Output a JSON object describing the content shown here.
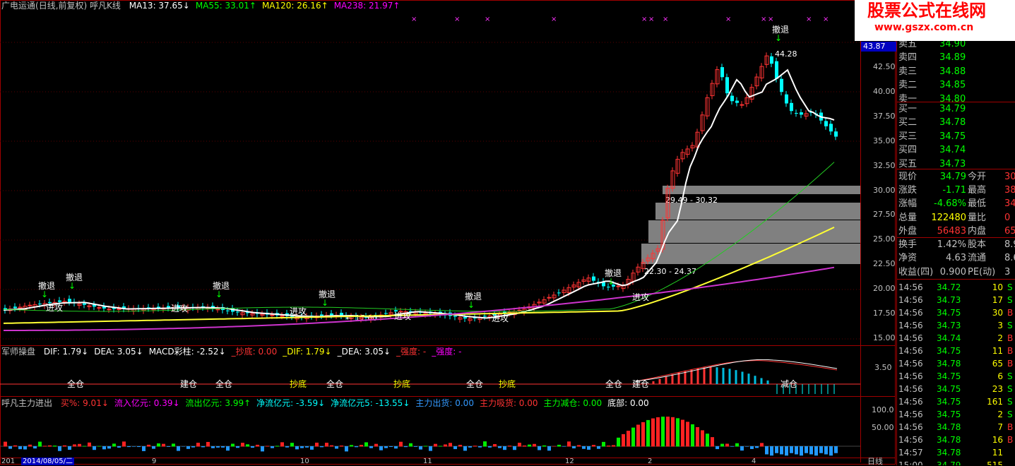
{
  "header": {
    "stock": "广电运通",
    "period": "(日线,前复权)",
    "indicator": "呼凡K线",
    "ma": [
      {
        "label": "MA13: 37.65",
        "arrow": "↓",
        "color": "#ffffff"
      },
      {
        "label": "MA55: 33.01",
        "arrow": "↑",
        "color": "#00ff00"
      },
      {
        "label": "MA120: 26.16",
        "arrow": "↑",
        "color": "#ffff00"
      },
      {
        "label": "MA238: 21.97",
        "arrow": "↑",
        "color": "#ff00ff"
      }
    ]
  },
  "watermark": {
    "line1": "股票公式在线网",
    "line2": "www.gszx.com.cn"
  },
  "price_axis": {
    "current_label": "43.87",
    "ticks": [
      "42.50",
      "40.00",
      "37.50",
      "35.00",
      "32.50",
      "30.00",
      "27.50",
      "25.00",
      "22.50",
      "20.00",
      "17.50",
      "15.00"
    ]
  },
  "annotations": {
    "high": "44.28",
    "low": "17.00",
    "range1": "29.49 - 30.32",
    "range2": "22.30 - 24.37",
    "retreat": "撤退",
    "attack": "进攻"
  },
  "macd_panel": {
    "name": "军师操盘",
    "items": [
      {
        "label": "DIF: 1.79",
        "arrow": "↓",
        "color": "#ffffff"
      },
      {
        "label": "DEA: 3.05",
        "arrow": "↓",
        "color": "#ffffff"
      },
      {
        "label": "MACD彩柱: -2.52",
        "arrow": "↓",
        "color": "#ffffff"
      },
      {
        "label": "_抄底: 0.00",
        "arrow": "",
        "color": "#ff3333"
      },
      {
        "label": "_DIF: 1.79",
        "arrow": "↓",
        "color": "#ffff00"
      },
      {
        "label": "_DEA: 3.05",
        "arrow": "↓",
        "color": "#ffffff"
      },
      {
        "label": "_强度: -",
        "arrow": "",
        "color": "#ff3333"
      },
      {
        "label": "_强度: -",
        "arrow": "",
        "color": "#ff00ff"
      }
    ],
    "axis_label": "3.50",
    "marks": {
      "full": "全仓",
      "build": "建仓",
      "bottom": "抄底",
      "reduce": "减仓"
    }
  },
  "fund_panel": {
    "name": "呼凡主力进出",
    "items": [
      {
        "label": "买%: 9.01",
        "arrow": "↓",
        "color": "#ff3333"
      },
      {
        "label": "流入亿元: 0.39",
        "arrow": "↓",
        "color": "#ff00ff"
      },
      {
        "label": "流出亿元: 3.99",
        "arrow": "↑",
        "color": "#00ff00"
      },
      {
        "label": "净流亿元: -3.59",
        "arrow": "↓",
        "color": "#00ffff"
      },
      {
        "label": "净流亿元5: -13.55",
        "arrow": "↓",
        "color": "#00ffff"
      },
      {
        "label": "主力出货: 0.00",
        "arrow": "",
        "color": "#3399ff"
      },
      {
        "label": "主力吸货: 0.00",
        "arrow": "",
        "color": "#ff3333"
      },
      {
        "label": "主力减仓: 0.00",
        "arrow": "",
        "color": "#00ff00"
      },
      {
        "label": "底部: 0.00",
        "arrow": "",
        "color": "#ffffff"
      }
    ],
    "axis": [
      "100.0",
      "50.00"
    ]
  },
  "time_axis": {
    "date": "2014/08/05/二",
    "months": [
      "9",
      "10",
      "11",
      "12",
      "2",
      "4"
    ],
    "mode": "日线"
  },
  "quote": {
    "asks": [
      {
        "label": "卖五",
        "price": "34.90"
      },
      {
        "label": "卖四",
        "price": "34.89"
      },
      {
        "label": "卖三",
        "price": "34.88"
      },
      {
        "label": "卖二",
        "price": "34.85"
      },
      {
        "label": "卖一",
        "price": "34.80"
      }
    ],
    "bids": [
      {
        "label": "买一",
        "price": "34.79"
      },
      {
        "label": "买二",
        "price": "34.78"
      },
      {
        "label": "买三",
        "price": "34.75"
      },
      {
        "label": "买四",
        "price": "34.74"
      },
      {
        "label": "买五",
        "price": "34.73"
      }
    ],
    "stats": [
      {
        "l1": "现价",
        "v1": "34.79",
        "c1": "#00ff00",
        "l2": "今开",
        "v2": "30"
      },
      {
        "l1": "涨跌",
        "v1": "-1.71",
        "c1": "#00ff00",
        "l2": "最高",
        "v2": "38"
      },
      {
        "l1": "涨幅",
        "v1": "-4.68%",
        "c1": "#00ff00",
        "l2": "最低",
        "v2": "34"
      },
      {
        "l1": "总量",
        "v1": "122480",
        "c1": "#ffff00",
        "l2": "量比",
        "v2": "0"
      },
      {
        "l1": "外盘",
        "v1": "56483",
        "c1": "#ff3333",
        "l2": "内盘",
        "v2": "65"
      }
    ],
    "stats2": [
      {
        "l1": "换手",
        "v1": "1.42%",
        "l2": "股本",
        "v2": "8.9"
      },
      {
        "l1": "净资",
        "v1": "4.63",
        "l2": "流通",
        "v2": "8.6"
      },
      {
        "l1": "收益(四)",
        "v1": "0.900",
        "l2": "PE(动)",
        "v2": "3"
      }
    ]
  },
  "ticks": [
    {
      "time": "14:56",
      "price": "34.72",
      "vol": "10",
      "side": "S"
    },
    {
      "time": "14:56",
      "price": "34.73",
      "vol": "17",
      "side": "S"
    },
    {
      "time": "14:56",
      "price": "34.75",
      "vol": "30",
      "side": "B"
    },
    {
      "time": "14:56",
      "price": "34.73",
      "vol": "3",
      "side": "S"
    },
    {
      "time": "14:56",
      "price": "34.74",
      "vol": "2",
      "side": "B"
    },
    {
      "time": "14:56",
      "price": "34.75",
      "vol": "11",
      "side": "B"
    },
    {
      "time": "14:56",
      "price": "34.78",
      "vol": "65",
      "side": "B"
    },
    {
      "time": "14:56",
      "price": "34.75",
      "vol": "6",
      "side": "S"
    },
    {
      "time": "14:56",
      "price": "34.75",
      "vol": "23",
      "side": "S"
    },
    {
      "time": "14:56",
      "price": "34.75",
      "vol": "161",
      "side": "S"
    },
    {
      "time": "14:56",
      "price": "34.75",
      "vol": "2",
      "side": "S"
    },
    {
      "time": "14:56",
      "price": "34.78",
      "vol": "7",
      "side": "B"
    },
    {
      "time": "14:56",
      "price": "34.78",
      "vol": "16",
      "side": "B"
    },
    {
      "time": "14:57",
      "price": "34.78",
      "vol": "11",
      "side": ""
    },
    {
      "time": "15:00",
      "price": "34.79",
      "vol": "515",
      "side": ""
    }
  ],
  "colors": {
    "up": "#ff3333",
    "down": "#00ffff",
    "buy": "#ff3333",
    "sell": "#00ff00"
  }
}
